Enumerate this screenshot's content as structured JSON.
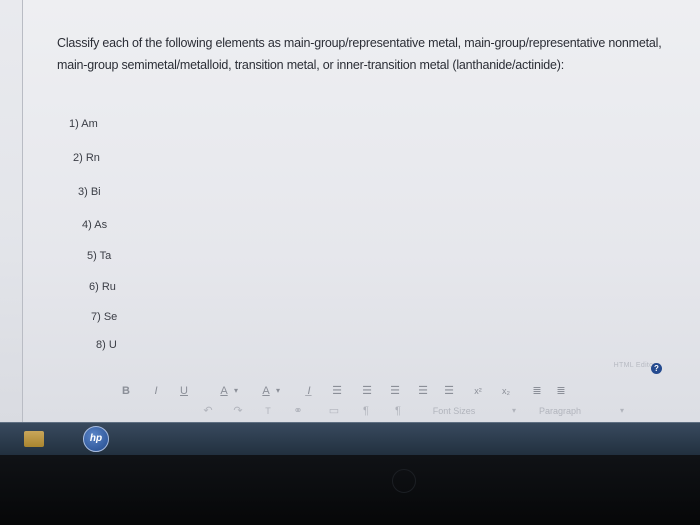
{
  "question": {
    "text": "Classify each of the following elements as main-group/representative metal, main-group/representative nonmetal, main-group semimetal/metalloid, transition metal, or inner-transition metal (lanthanide/actinide):"
  },
  "items": [
    {
      "label": "1) Am"
    },
    {
      "label": "2) Rn"
    },
    {
      "label": "3) Bi"
    },
    {
      "label": "4) As"
    },
    {
      "label": "5) Ta"
    },
    {
      "label": "6) Ru"
    },
    {
      "label": "7) Se"
    },
    {
      "label": "8) U"
    }
  ],
  "editor": {
    "html_editor_label": "HTML Editor",
    "help_label": "?",
    "row1": {
      "bold": "B",
      "italic": "I",
      "underline": "U",
      "font_color": "A",
      "bg_color": "A",
      "clear_format": "I̲",
      "superscript": "x²",
      "subscript": "x₂"
    },
    "row2": {
      "pilcrow": "¶",
      "font_sizes": "Font Sizes",
      "paragraph": "Paragraph"
    }
  },
  "taskbar": {
    "hp_label": "hp"
  }
}
